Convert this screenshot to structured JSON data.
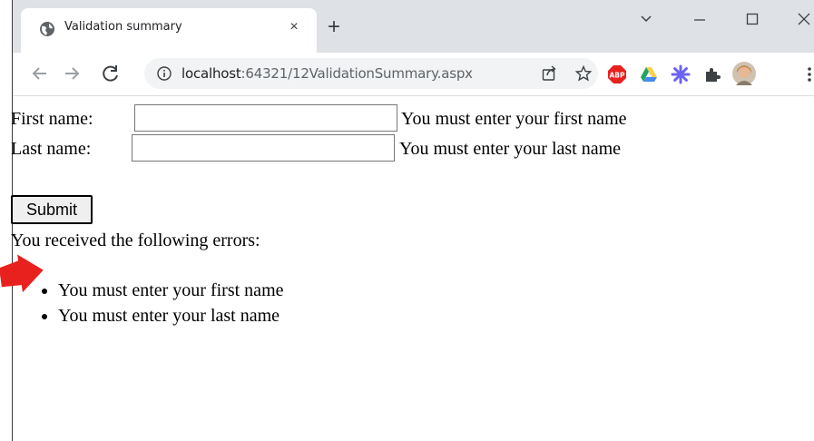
{
  "browser": {
    "tab_title": "Validation summary",
    "tab_close_glyph": "×",
    "new_tab_glyph": "+",
    "url_host": "localhost",
    "url_rest": ":64321/12ValidationSummary.aspx",
    "window_controls": [
      "⌵",
      "—",
      "☐",
      "✕"
    ]
  },
  "form": {
    "first_name_label": "First name:",
    "first_name_value": "",
    "first_name_error": "You must enter your first name",
    "last_name_label": "Last name:",
    "last_name_value": "",
    "last_name_error": "You must enter your last name",
    "submit_label": "Submit"
  },
  "summary": {
    "header": "You received the following errors:",
    "items": [
      "You must enter your first name",
      "You must enter your last name"
    ]
  },
  "colors": {
    "tabstrip": "#dee1e6",
    "arrow": "#e8201e",
    "google_drive": [
      "#1fa463",
      "#ffd04b",
      "#4688f4"
    ]
  },
  "icons": [
    "globe-icon",
    "info-icon",
    "share-icon",
    "star-icon",
    "adblock-icon",
    "google-drive-icon",
    "sparkle-icon",
    "puzzle-icon",
    "profile-avatar"
  ]
}
